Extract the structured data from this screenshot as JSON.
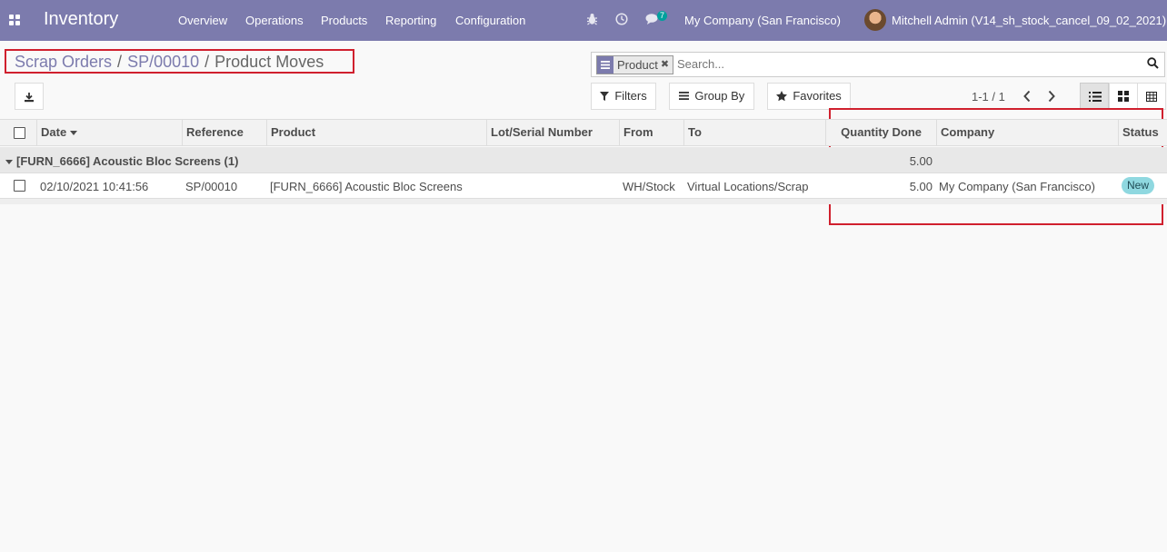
{
  "navbar": {
    "app_name": "Inventory",
    "menu": [
      "Overview",
      "Operations",
      "Products",
      "Reporting",
      "Configuration"
    ],
    "messages_count": "7",
    "company": "My Company (San Francisco)",
    "user": "Mitchell Admin (V14_sh_stock_cancel_09_02_2021)",
    "icons": [
      "apps-grid-icon",
      "bug-icon",
      "clock-icon",
      "chat-icon"
    ]
  },
  "breadcrumb": {
    "items": [
      "Scrap Orders",
      "SP/00010"
    ],
    "current": "Product Moves",
    "separator": "/"
  },
  "search": {
    "facet_value": "Product",
    "placeholder": "Search..."
  },
  "toolbar": {
    "filters": "Filters",
    "group_by": "Group By",
    "favorites": "Favorites",
    "pager": "1-1 / 1"
  },
  "table": {
    "columns": [
      "Date",
      "Reference",
      "Product",
      "Lot/Serial Number",
      "From",
      "To",
      "Quantity Done",
      "Company",
      "Status"
    ],
    "group": {
      "title": "[FURN_6666] Acoustic Bloc Screens (1)",
      "quantity_sum": "5.00"
    },
    "rows": [
      {
        "date": "02/10/2021 10:41:56",
        "reference": "SP/00010",
        "product": "[FURN_6666] Acoustic Bloc Screens",
        "lot": "",
        "from": "WH/Stock",
        "to": "Virtual Locations/Scrap",
        "quantity": "5.00",
        "company": "My Company (San Francisco)",
        "status": "New"
      }
    ]
  },
  "colors": {
    "navbar": "#7c7bad",
    "link": "#7c7bad",
    "highlight_box": "#d0202e",
    "status_new": "#8fd8e0"
  }
}
